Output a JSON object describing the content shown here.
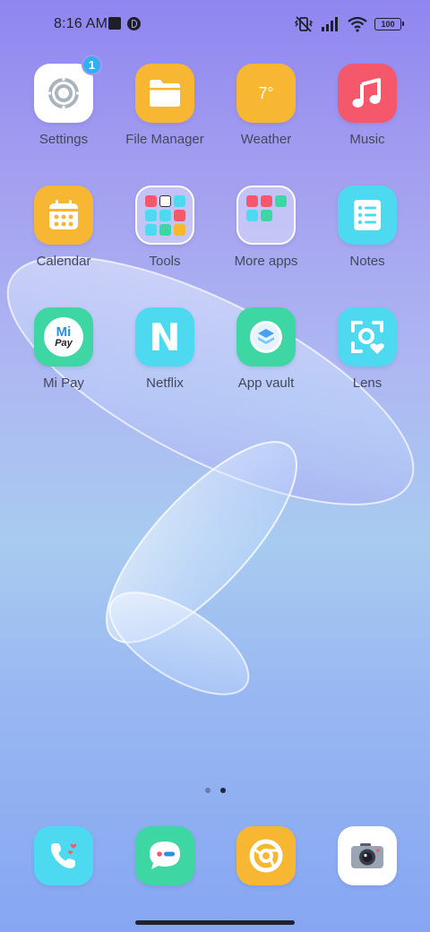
{
  "status_bar": {
    "time": "8:16 AM",
    "battery": "100",
    "icons": [
      "notification-square-icon",
      "notification-app-icon",
      "vibrate-off-icon",
      "signal-icon",
      "wifi-icon",
      "battery-icon"
    ]
  },
  "apps": [
    {
      "label": "Settings",
      "icon": "settings-gear-icon",
      "color": "#ffffff",
      "badge": "1"
    },
    {
      "label": "File Manager",
      "icon": "folder-icon",
      "color": "#f7b733"
    },
    {
      "label": "Weather",
      "icon": "weather-icon",
      "color": "#f7b733",
      "icon_text": "7°"
    },
    {
      "label": "Music",
      "icon": "music-note-icon",
      "color": "#f5586a"
    },
    {
      "label": "Calendar",
      "icon": "calendar-icon",
      "color": "#f7b733"
    },
    {
      "label": "Tools",
      "icon": "folder-tools-icon",
      "color": "folder"
    },
    {
      "label": "More apps",
      "icon": "folder-more-apps-icon",
      "color": "folder"
    },
    {
      "label": "Notes",
      "icon": "notes-list-icon",
      "color": "#4ddaf0"
    },
    {
      "label": "Mi Pay",
      "icon": "mi-pay-icon",
      "color": "#3ed6a2",
      "icon_text_top": "Mi",
      "icon_text_bottom": "Pay"
    },
    {
      "label": "Netflix",
      "icon": "netflix-n-icon",
      "color": "#4ddaf0",
      "icon_text": "N"
    },
    {
      "label": "App vault",
      "icon": "app-vault-icon",
      "color": "#3ed6a2"
    },
    {
      "label": "Lens",
      "icon": "lens-scan-icon",
      "color": "#4ddaf0"
    }
  ],
  "dock": [
    {
      "name": "phone",
      "icon": "phone-icon",
      "color": "#4ddaf0"
    },
    {
      "name": "messages",
      "icon": "message-bubble-icon",
      "color": "#3ed6a2"
    },
    {
      "name": "browser",
      "icon": "browser-icon",
      "color": "#f7b733"
    },
    {
      "name": "camera",
      "icon": "camera-icon",
      "color": "#ffffff"
    }
  ],
  "pages": {
    "count": 2,
    "active": 2
  }
}
